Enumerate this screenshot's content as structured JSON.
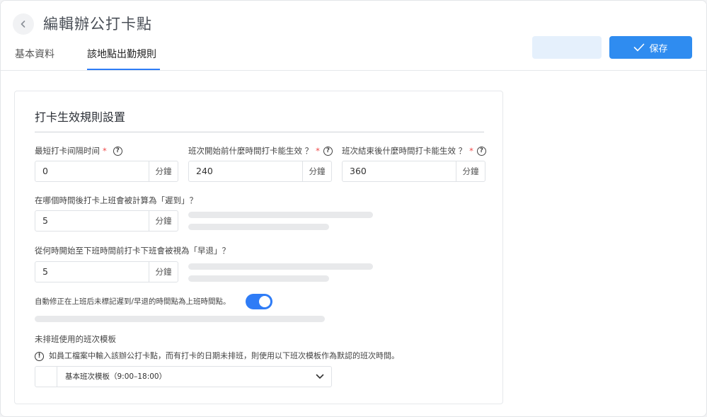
{
  "header": {
    "title": "編輯辦公打卡點",
    "tabs": [
      {
        "label": "基本資料",
        "active": false
      },
      {
        "label": "該地點出勤規則",
        "active": true
      }
    ],
    "secondary_button_label": "",
    "save_label": "保存"
  },
  "card": {
    "title": "打卡生效規則設置",
    "fields": [
      {
        "label": "最短打卡间隔时间",
        "required": true,
        "value": "0",
        "unit": "分鐘"
      },
      {
        "label": "班次開始前什麼時間打卡能生效 ？",
        "required": true,
        "value": "240",
        "unit": "分鐘"
      },
      {
        "label": "班次結束後什麼時間打卡能生效 ？",
        "required": true,
        "value": "360",
        "unit": "分鐘"
      },
      {
        "label": "在哪個時間後打卡上班會被計算為「遲到」？",
        "required": false,
        "value": "5",
        "unit": "分鐘"
      },
      {
        "label": "從何時開始至下班時間前打卡下班會被視為「早退」？",
        "required": false,
        "value": "5",
        "unit": "分鐘"
      }
    ],
    "required_mark": "*",
    "help_glyph": "?",
    "auto_correct_label": "自動修正在上班后未標記遲到/早退的時間點為上班時間點。",
    "auto_correct_enabled": true,
    "template_label": "未排班使用的班次模板",
    "template_note": "如員工檔案中輸入該辦公打卡點，而有打卡的日期未排班，則使用以下班次模板作為默認的班次時間。",
    "warn_glyph": "!",
    "template_value": "基本班次模板（9:00–18:00）"
  },
  "colors": {
    "accent": "#2f8cf0",
    "toggle_on": "#2f7cf6",
    "required": "#f04848",
    "secondary_button_bg": "#e5f0fc"
  },
  "icons": {
    "back": "chevron-left-icon",
    "save": "check-icon",
    "help": "question-circle-icon",
    "warning": "exclamation-circle-icon",
    "dropdown": "chevron-down-icon"
  }
}
